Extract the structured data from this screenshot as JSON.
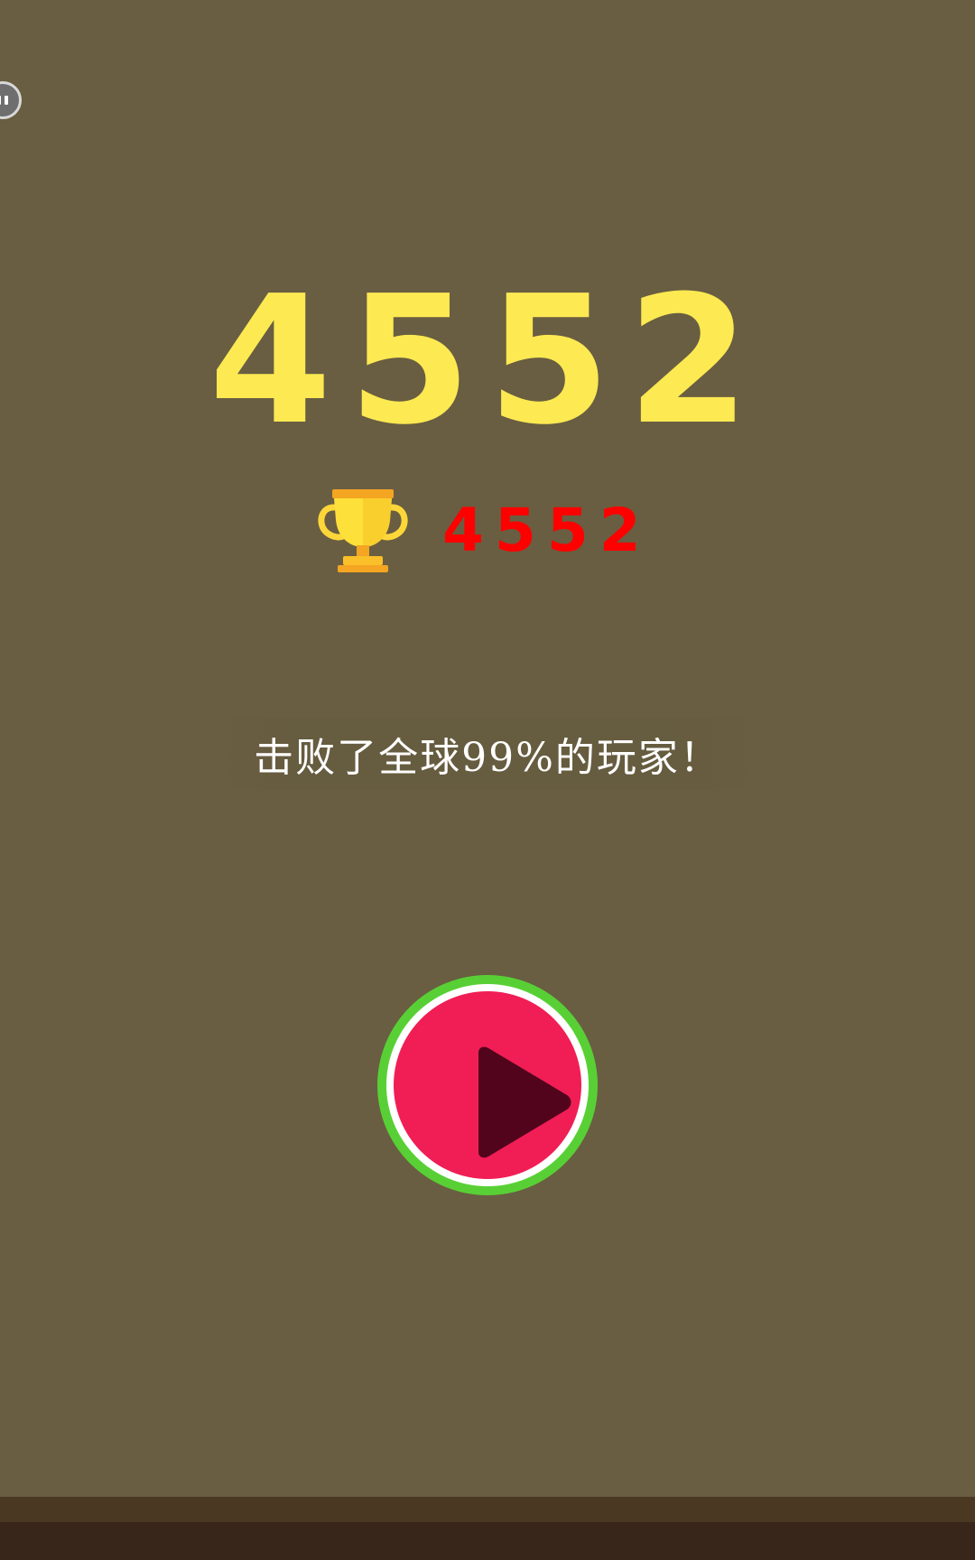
{
  "game": {
    "score": "4552",
    "best_score": "4552",
    "rank_message": "击败了全球99%的玩家！"
  },
  "icons": {
    "floating_button": "pause-icon",
    "best": "trophy-icon",
    "play": "play-icon"
  },
  "colors": {
    "background": "#695e41",
    "score": "#fde952",
    "best_score": "#ff0000",
    "play_ring": "#58d035",
    "play_fill": "#f01e55",
    "play_triangle": "#52041d",
    "ground_top": "#4b3823",
    "ground_bottom": "#372619"
  }
}
